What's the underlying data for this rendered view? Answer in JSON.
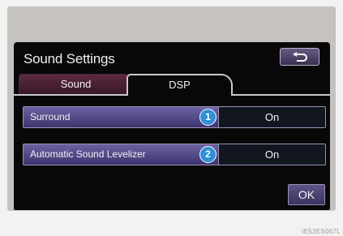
{
  "screen": {
    "title": "Sound Settings"
  },
  "tabs": [
    {
      "label": "Sound",
      "active": false
    },
    {
      "label": "DSP",
      "active": true
    }
  ],
  "settings": [
    {
      "label": "Surround",
      "badge": "1",
      "value": "On"
    },
    {
      "label": "Automatic Sound Levelizer",
      "badge": "2",
      "value": "On"
    }
  ],
  "ok_label": "OK",
  "image_code": "IE53ES067L",
  "icons": {
    "back": "return-arrow-icon"
  },
  "colors": {
    "accent_button": "#5e5486",
    "badge": "#2f8fd9",
    "inactive_tab": "#5a2840"
  }
}
